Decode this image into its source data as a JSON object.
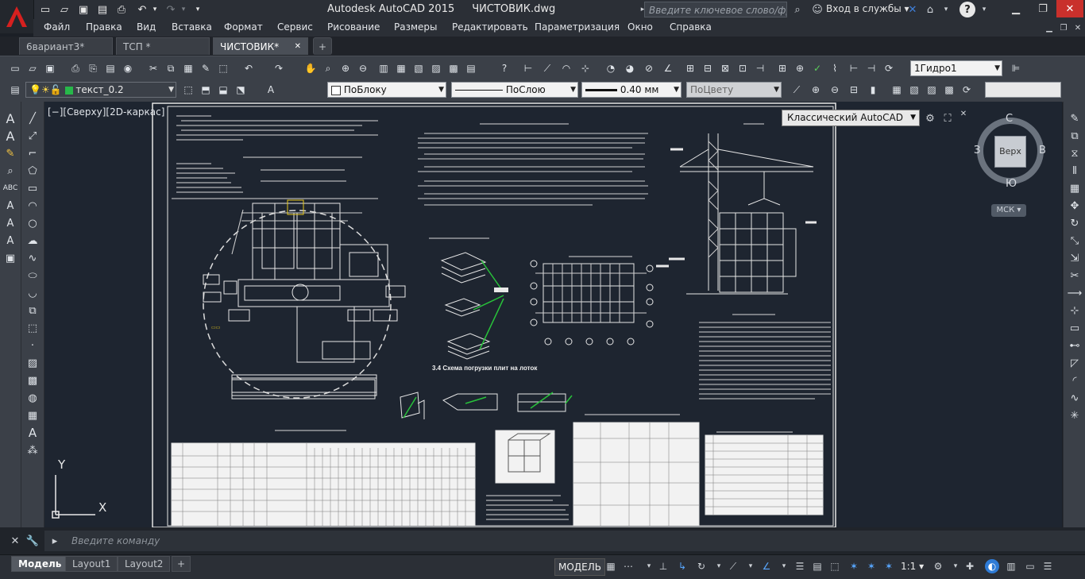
{
  "window": {
    "title": "Autodesk AutoCAD 2015",
    "drawing": "ЧИСТОВИК.dwg",
    "search_placeholder": "Введите ключевое слово/фразу",
    "login": "Вход в службы",
    "help": "?"
  },
  "menu": [
    "Файл",
    "Правка",
    "Вид",
    "Вставка",
    "Формат",
    "Сервис",
    "Рисование",
    "Размеры",
    "Редактировать",
    "Параметризация",
    "Окно",
    "Справка"
  ],
  "file_tabs": [
    {
      "label": "6вариант3*",
      "active": false
    },
    {
      "label": "ТСП *",
      "active": false
    },
    {
      "label": "ЧИСТОВИК*",
      "active": true
    }
  ],
  "toolbar": {
    "dimstyle": "1Гидро1",
    "layer": "текст_0.2",
    "color": "ПоБлоку",
    "linetype": "ПоСлою",
    "lineweight": "0.40 мм",
    "plotstyle": "ПоЦвету",
    "layer_color": "#27b84a"
  },
  "viewport": {
    "label": "[−][Сверху][2D-каркас]",
    "workspace": "Классический AutoCAD"
  },
  "viewcube": {
    "face": "Верх",
    "north": "С",
    "south": "Ю",
    "west": "З",
    "east": "В",
    "ucs": "МСК"
  },
  "ucs_axes": {
    "x": "X",
    "y": "Y"
  },
  "command": {
    "placeholder": "Введите команду"
  },
  "layouts": [
    {
      "label": "Модель",
      "active": true
    },
    {
      "label": "Layout1",
      "active": false
    },
    {
      "label": "Layout2",
      "active": false
    }
  ],
  "status": {
    "mode": "МОДЕЛЬ",
    "scale": "1:1"
  },
  "drawing_sheet": {
    "title_section1": "1. Область применения",
    "title_section2": "2. ОРГАНИЗАЦИЯ И ТЕХНОЛОГИЯ ПРОИЗВОДСТВА РАБОТ",
    "title_section3": "3. Материалы по производству работ",
    "title_section4": "3.1. Схемы складирования ж/б элементов",
    "title_section5": "3.2. Разбивка захваток блоков",
    "title_section6": "3. ТЕХНИКА БЕЗОПАСНОСТИ",
    "title_section7": "5. ГРАФИК ПРОИЗВОДСТВА РАБОТ",
    "title_section8": "3. ОПЕРАЦИОННЫЙ КОНТРОЛЬ КАЧЕСТВА РАБОТ",
    "title_section9": "6. ТЕХНИКО-ЭКОНОМИЧЕСКИЕ ПОКАЗАТЕЛИ",
    "crane_label": "1 — 1 М 1:200"
  }
}
